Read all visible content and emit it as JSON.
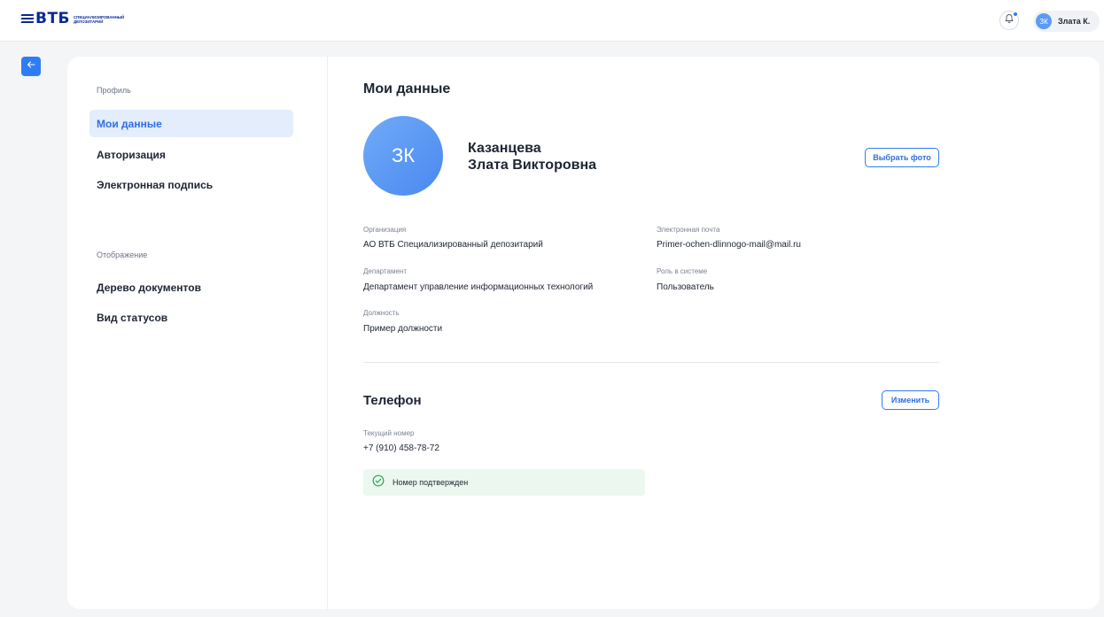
{
  "header": {
    "logo_text": "ВТБ",
    "logo_subtitle_line1": "СПЕЦИАЛИЗИРОВАННЫЙ",
    "logo_subtitle_line2": "ДЕПОЗИТАРИЙ",
    "user_initials": "ЗК",
    "user_name": "Злата К."
  },
  "sidebar": {
    "profile_section_label": "Профиль",
    "profile_items": [
      {
        "label": "Мои данные",
        "active": true
      },
      {
        "label": "Авторизация",
        "active": false
      },
      {
        "label": "Электронная подпись",
        "active": false
      }
    ],
    "display_section_label": "Отображение",
    "display_items": [
      {
        "label": "Дерево документов"
      },
      {
        "label": "Вид статусов"
      }
    ]
  },
  "profile": {
    "title": "Мои данные",
    "avatar_initials": "ЗК",
    "last_name": "Казанцева",
    "first_middle_name": "Злата Викторовна",
    "choose_photo_label": "Выбрать фото",
    "fields": {
      "organization": {
        "label": "Организация",
        "value": "АО ВТБ Специализированный депозитарий"
      },
      "email": {
        "label": "Электронная почта",
        "value": "Primer-ochen-dlinnogo-mail@mail.ru"
      },
      "department": {
        "label": "Департамент",
        "value": "Департамент управление информационных технологий"
      },
      "role": {
        "label": "Роль в системе",
        "value": "Пользователь"
      },
      "position": {
        "label": "Должность",
        "value": "Пример должности"
      }
    }
  },
  "phone": {
    "title": "Телефон",
    "change_label": "Изменить",
    "current_label": "Текущий номер",
    "current_value": "+7 (910) 458-78-72",
    "status_text": "Номер подтвержден"
  },
  "colors": {
    "accent": "#2e7df6",
    "brand": "#0a2896",
    "success_bg": "#ebf7ef",
    "success_icon": "#22a652",
    "active_nav_bg": "#e3edfc"
  }
}
